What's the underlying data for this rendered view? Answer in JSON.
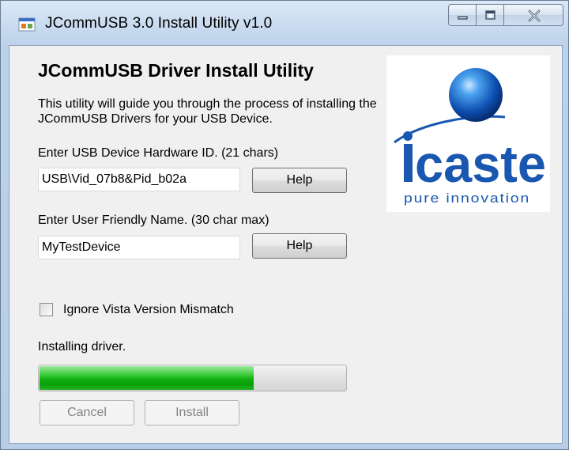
{
  "window": {
    "title": "JCommUSB 3.0 Install Utility v1.0"
  },
  "main": {
    "heading": "JCommUSB Driver Install Utility",
    "description": "This utility will guide you through the process of installing the JCommUSB Drivers for your USB Device.",
    "hardware_id_label": "Enter USB Device Hardware ID. (21 chars)",
    "hardware_id_value": "USB\\Vid_07b8&Pid_b02a",
    "friendly_name_label": "Enter User Friendly Name. (30 char max)",
    "friendly_name_value": "MyTestDevice",
    "help_label": "Help",
    "ignore_mismatch_label": "Ignore Vista Version Mismatch",
    "ignore_mismatch_checked": false,
    "status_text": "Installing driver.",
    "progress_fraction": 0.7,
    "cancel_label": "Cancel",
    "install_label": "Install"
  },
  "logo": {
    "brand": "icaste",
    "tagline": "pure innovation"
  },
  "colors": {
    "accent_blue": "#1a57b0",
    "progress_green": "#12b012"
  },
  "icons": {
    "app": "app-window-icon",
    "minimize": "minimize-icon",
    "maximize": "maximize-icon",
    "close": "close-icon"
  }
}
